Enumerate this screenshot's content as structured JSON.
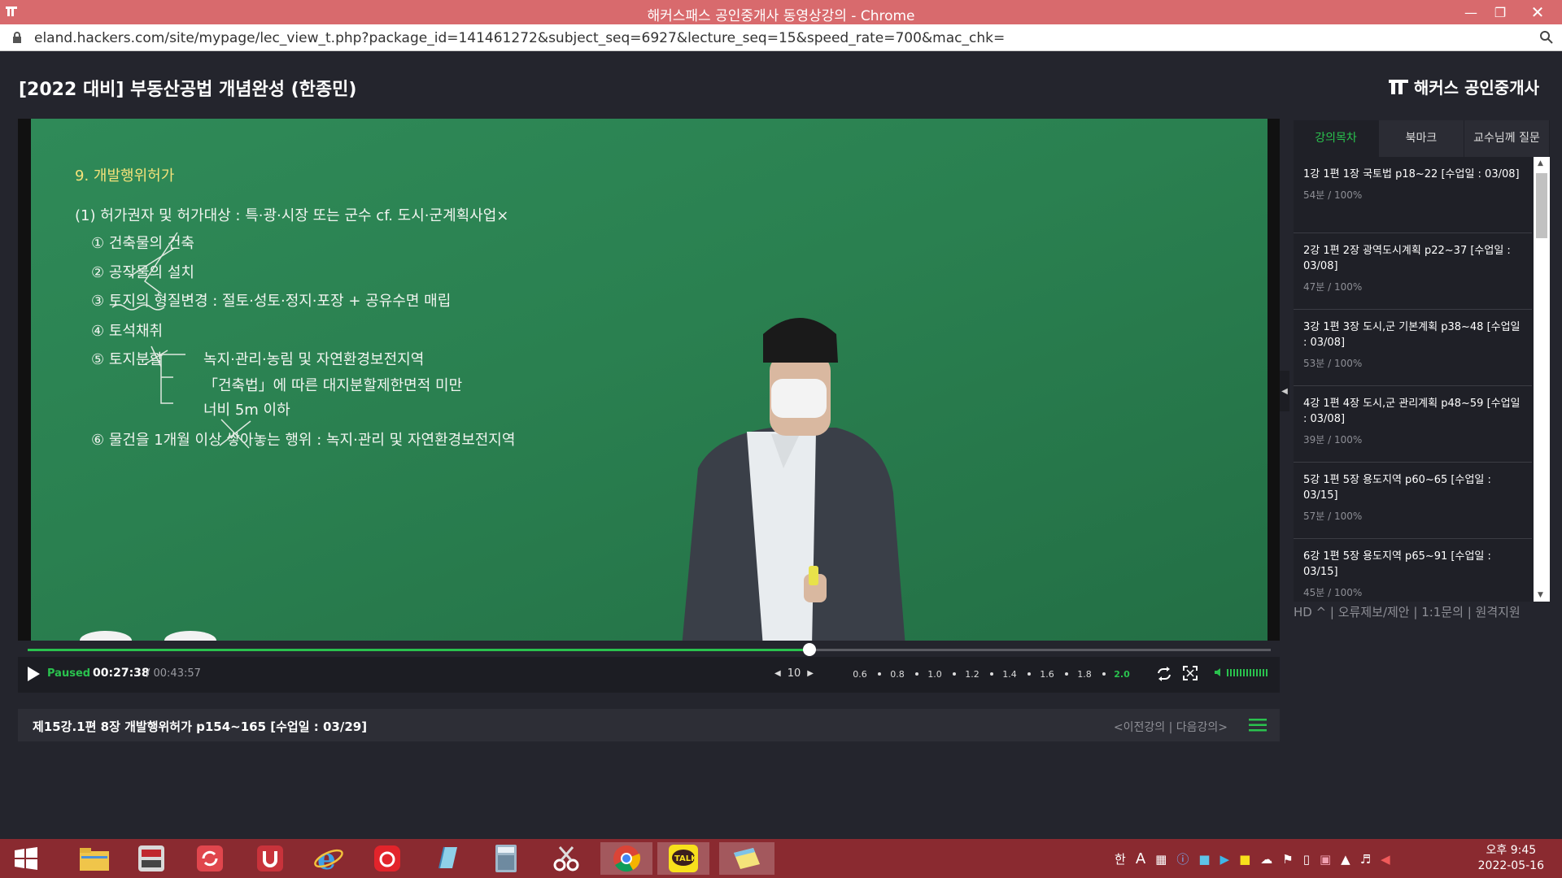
{
  "window": {
    "title": "해커스패스 공인중개사 동영상강의 - Chrome",
    "url": "eland.hackers.com/site/mypage/lec_view_t.php?package_id=141461272&subject_seq=6927&lecture_seq=15&speed_rate=700&mac_chk="
  },
  "header": {
    "course_title": "[2022 대비] 부동산공법 개념완성 (한종민)",
    "brand": "해커스 공인중개사"
  },
  "board": {
    "lines": [
      "9. 개발행위허가",
      "(1) 허가권자 및 허가대상 : 특·광·시장 또는 군수  cf. 도시·군계획사업×",
      "① 건축물의 건축",
      "② 공작물의 설치",
      "③ 토지의 형질변경 : 절토·성토·정지·포장 + 공유수면 매립",
      "④ 토석채취",
      "⑤ 토지분할",
      "녹지·관리·농림 및 자연환경보전지역",
      "「건축법」에 따른 대지분할제한면적 미만",
      "너비 5m 이하",
      "⑥ 물건을 1개월 이상 쌓아놓는 행위 : 녹지·관리 및 자연환경보전지역"
    ]
  },
  "player": {
    "status": "Paused",
    "current_time": "00:27:38",
    "total_time": "/ 00:43:57",
    "progress": 0.629,
    "seek_seconds": "10",
    "speeds": [
      "0.6",
      "0.8",
      "1.0",
      "1.2",
      "1.4",
      "1.6",
      "1.8",
      "2.0"
    ],
    "active_speed": "2.0"
  },
  "info": {
    "lecture": "제15강.1편 8장 개발행위허가 p154~165 [수업일 : 03/29]",
    "nav": "<이전강의 | 다음강의>"
  },
  "sidebar": {
    "tabs": [
      "강의목차",
      "북마크",
      "교수님께 질문"
    ],
    "items": [
      {
        "title": "1강 1편 1장 국토법 p18~22 [수업일 : 03/08]",
        "meta": "54분 / 100%"
      },
      {
        "title": "2강 1편 2장 광역도시계획 p22~37 [수업일 : 03/08]",
        "meta": "47분 / 100%"
      },
      {
        "title": "3강 1편 3장 도시,군 기본계획 p38~48 [수업일 : 03/08]",
        "meta": "53분 / 100%"
      },
      {
        "title": "4강 1편 4장 도시,군 관리계획 p48~59 [수업일 : 03/08]",
        "meta": "39분 / 100%"
      },
      {
        "title": "5강 1편 5장 용도지역 p60~65 [수업일 : 03/15]",
        "meta": "57분 / 100%"
      },
      {
        "title": "6강 1편 5장 용도지역 p65~91 [수업일 : 03/15]",
        "meta": "45분 / 100%"
      }
    ],
    "links": "HD ^  |  오류제보/제안  |  1:1문의  |  원격지원"
  },
  "taskbar": {
    "ime_han": "한",
    "ime_a": "A",
    "time": "오후 9:45",
    "date": "2022-05-16"
  },
  "colors": {
    "accent_green": "#2ac24e",
    "titlebar": "#d86a6d",
    "taskbar": "#8a2a30",
    "background": "#24252d"
  }
}
